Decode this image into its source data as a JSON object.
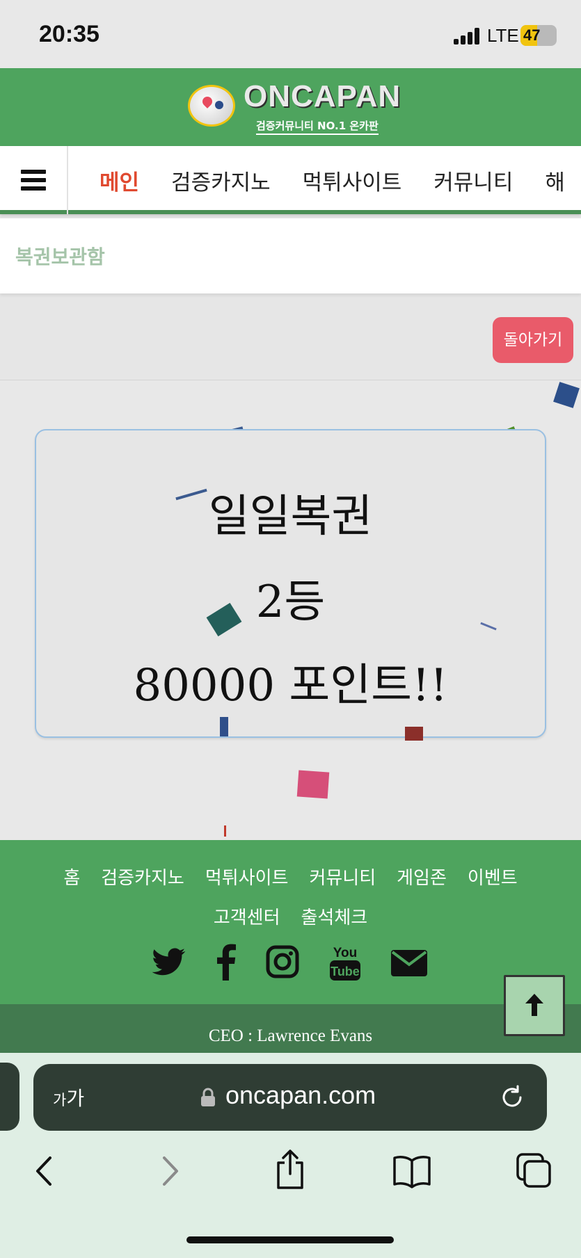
{
  "status_bar": {
    "time": "20:35",
    "network": "LTE",
    "battery": "47",
    "battery_level": 0.47
  },
  "header": {
    "logo_text": "ONCAPAN",
    "logo_subtitle": "검증커뮤니티 NO.1 온카판"
  },
  "nav": {
    "menu_icon": "hamburger-menu-icon",
    "items": [
      "메인",
      "검증카지노",
      "먹튀사이트",
      "커뮤니티",
      "해"
    ],
    "active_color": "#e0492f"
  },
  "breadcrumb": "복권보관함",
  "back_button": "돌아가기",
  "lottery": {
    "title": "일일복권",
    "rank": "2등",
    "prize": "80000 포인트!!"
  },
  "footer": {
    "links": [
      "홈",
      "검증카지노",
      "먹튀사이트",
      "커뮤니티",
      "게임존",
      "이벤트",
      "고객센터",
      "출석체크"
    ],
    "social_icons": [
      "twitter-icon",
      "facebook-icon",
      "instagram-icon",
      "youtube-icon",
      "email-icon"
    ],
    "ceo": "CEO : Lawrence Evans",
    "brand_color": "#4ea45e"
  },
  "scroll_top_icon": "arrow-up-icon",
  "browser": {
    "text_size_label": "가가",
    "url": "oncapan.com",
    "toolbar_icons": [
      "back-icon",
      "forward-icon",
      "share-icon",
      "bookmarks-icon",
      "tabs-icon"
    ]
  }
}
